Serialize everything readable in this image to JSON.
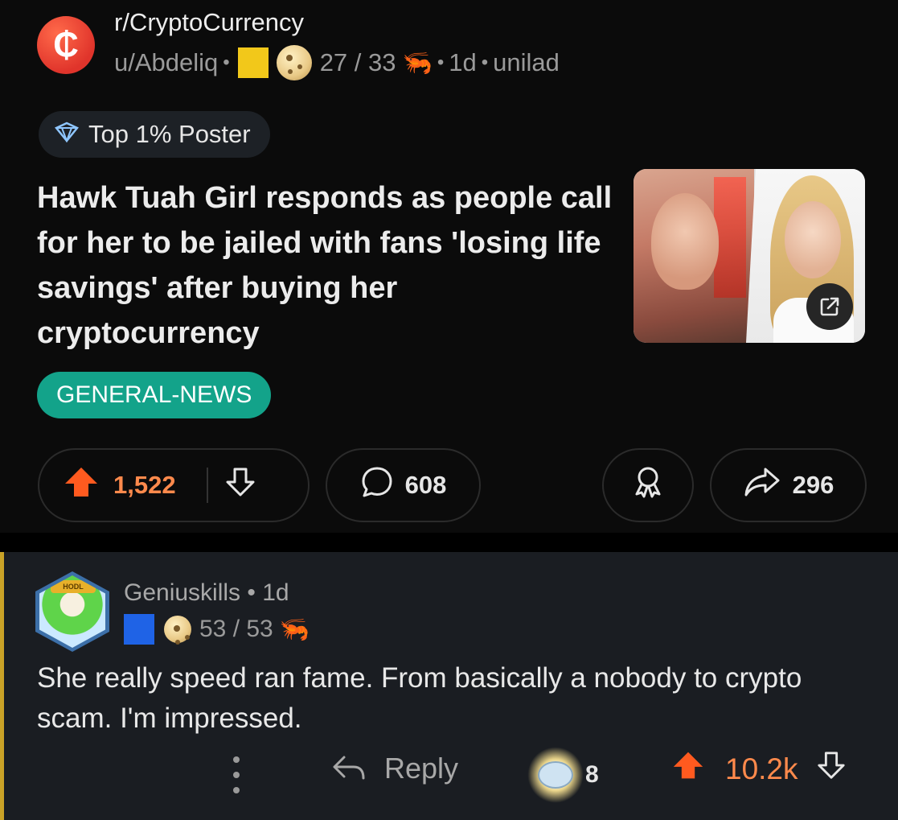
{
  "post": {
    "subreddit": "r/CryptoCurrency",
    "subreddit_icon_glyph": "₵",
    "author": "u/Abdeliq",
    "karma": "27 / 33",
    "age": "1d",
    "source": "unilad",
    "flair": "Top 1% Poster",
    "title": "Hawk Tuah Girl responds as people call for her to be jailed with fans 'losing life savings' after buying her cryptocurrency",
    "tag": "GENERAL-NEWS",
    "upvotes": "1,522",
    "comments": "608",
    "shares": "296"
  },
  "comment": {
    "author": "Geniuskills",
    "age": "1d",
    "karma": "53 / 53",
    "avatar_hat_text": "HODL",
    "body": "She really speed ran fame. From basically a nobody to crypto scam. I'm impressed.",
    "reply_label": "Reply",
    "award_count": "8",
    "score": "10.2k"
  },
  "colors": {
    "accent_upvote": "#ff8a4c",
    "tag_bg": "#13a38a",
    "subreddit_icon": "#e0342b",
    "comment_bar": "#c9a227"
  }
}
